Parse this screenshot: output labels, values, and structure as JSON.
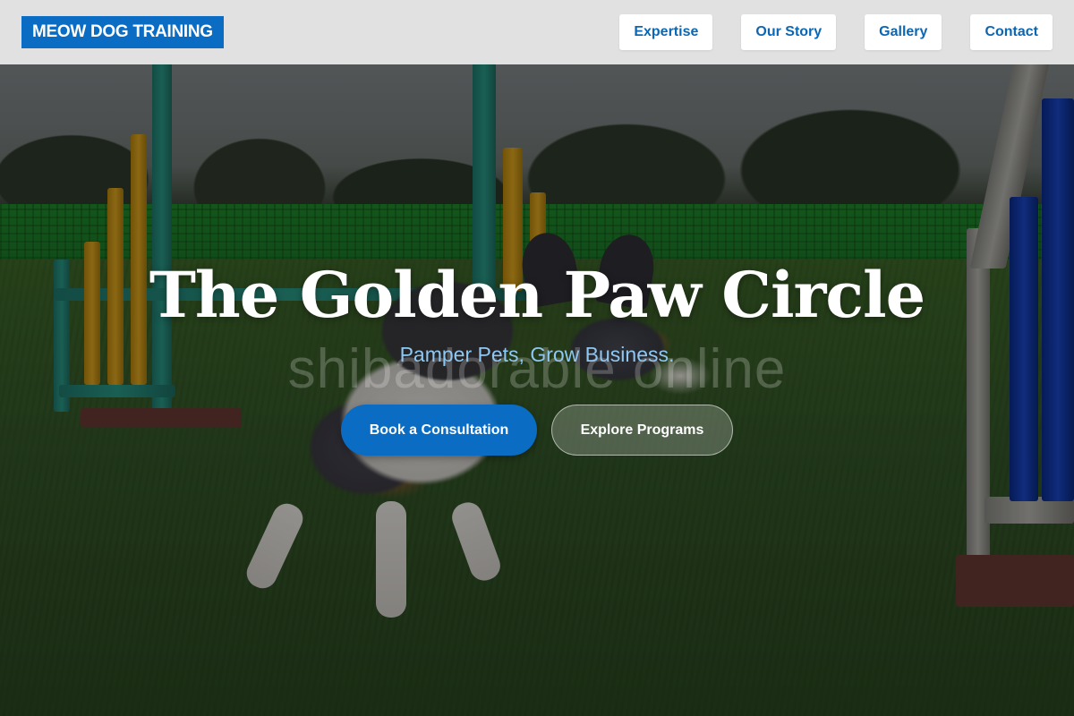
{
  "header": {
    "logo_text": "MEOW DOG TRAINING",
    "nav": [
      {
        "label": "Expertise"
      },
      {
        "label": "Our Story"
      },
      {
        "label": "Gallery"
      },
      {
        "label": "Contact"
      }
    ]
  },
  "hero": {
    "background_image": "dog-agility-photo",
    "title": "The Golden Paw Circle",
    "watermark": "shibadorable online",
    "subtitle": "Pamper Pets, Grow Business.",
    "primary_button": "Book a Consultation",
    "secondary_button": "Explore Programs"
  },
  "colors": {
    "accent": "#0a6cc2",
    "subtitle": "#8ec8f2",
    "header_bg": "#ececec"
  }
}
